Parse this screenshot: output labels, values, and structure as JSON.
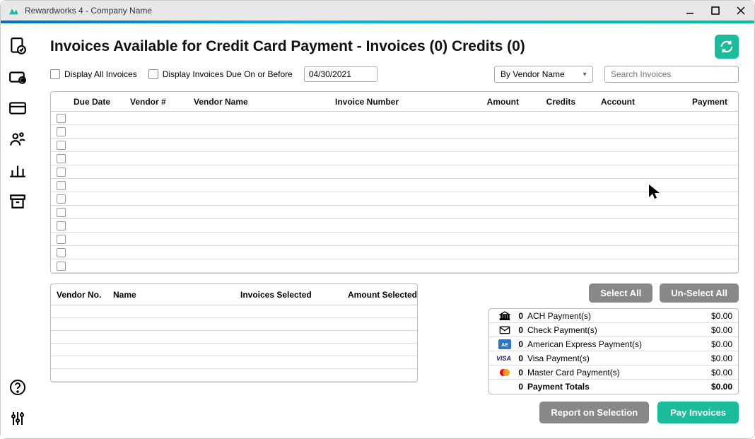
{
  "window": {
    "title": "Rewardworks 4 - Company Name"
  },
  "page": {
    "title": "Invoices Available for Credit Card Payment - Invoices (0) Credits (0)"
  },
  "filters": {
    "display_all_label": "Display All Invoices",
    "display_due_label": "Display Invoices Due On or Before",
    "date_value": "04/30/2021",
    "sort_selected": "By Vendor Name",
    "search_placeholder": "Search Invoices"
  },
  "invoice_columns": {
    "c0": "",
    "c1": "Due Date",
    "c2": "Vendor #",
    "c3": "Vendor Name",
    "c4": "Invoice Number",
    "c5": "Amount",
    "c6": "Credits",
    "c7": "Account",
    "c8": "Payment"
  },
  "summary_columns": {
    "c0": "Vendor No.",
    "c1": "Name",
    "c2": "Invoices Selected",
    "c3": "Amount Selected"
  },
  "buttons": {
    "select_all": "Select All",
    "unselect_all": "Un-Select All",
    "report": "Report on Selection",
    "pay": "Pay Invoices"
  },
  "totals": [
    {
      "count": "0",
      "label": "ACH Payment(s)",
      "amount": "$0.00",
      "icon": "bank"
    },
    {
      "count": "0",
      "label": "Check Payment(s)",
      "amount": "$0.00",
      "icon": "envelope"
    },
    {
      "count": "0",
      "label": "American Express Payment(s)",
      "amount": "$0.00",
      "icon": "amex"
    },
    {
      "count": "0",
      "label": "Visa Payment(s)",
      "amount": "$0.00",
      "icon": "visa"
    },
    {
      "count": "0",
      "label": "Master Card Payment(s)",
      "amount": "$0.00",
      "icon": "mastercard"
    },
    {
      "count": "0",
      "label": "Payment Totals",
      "amount": "$0.00",
      "icon": ""
    }
  ]
}
